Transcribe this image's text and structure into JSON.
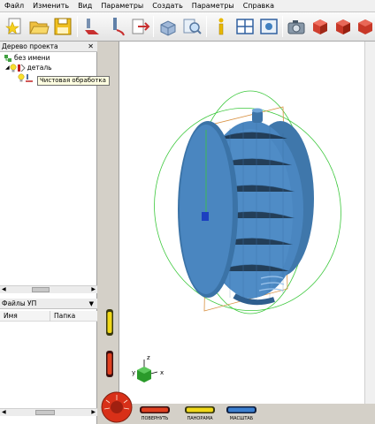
{
  "menubar": {
    "items": [
      "Файл",
      "Изменить",
      "Вид",
      "Параметры",
      "Создать",
      "Параметры",
      "Справка"
    ]
  },
  "toolbar": {
    "buttons": [
      "new-document-icon",
      "open-folder-icon",
      "save-icon",
      "toolpath-icon",
      "tool-icon",
      "export-icon",
      "stock-icon",
      "inspect-icon",
      "info-icon",
      "layout-icon",
      "properties-icon",
      "camera-icon",
      "shaded-cube-icon",
      "material-cube-icon",
      "render-cube-icon"
    ]
  },
  "project_tree": {
    "header": "Дерево проекта",
    "root": "без имени",
    "part": "деталь",
    "operation_tooltip": "Чистовая обработка"
  },
  "files_panel": {
    "header": "Файлы УП",
    "columns": [
      "Имя",
      "Папка"
    ]
  },
  "viewport": {
    "axes": {
      "x": "x",
      "y": "y",
      "z": "z"
    },
    "model_color": "#4a86c0",
    "bbox_color": "#3cc83c"
  },
  "bottom_bar": {
    "rotate_label": "ПОВЕРНУТЬ",
    "pan_label": "ПАНОРАМА",
    "zoom_label": "МАСШТАБ"
  }
}
